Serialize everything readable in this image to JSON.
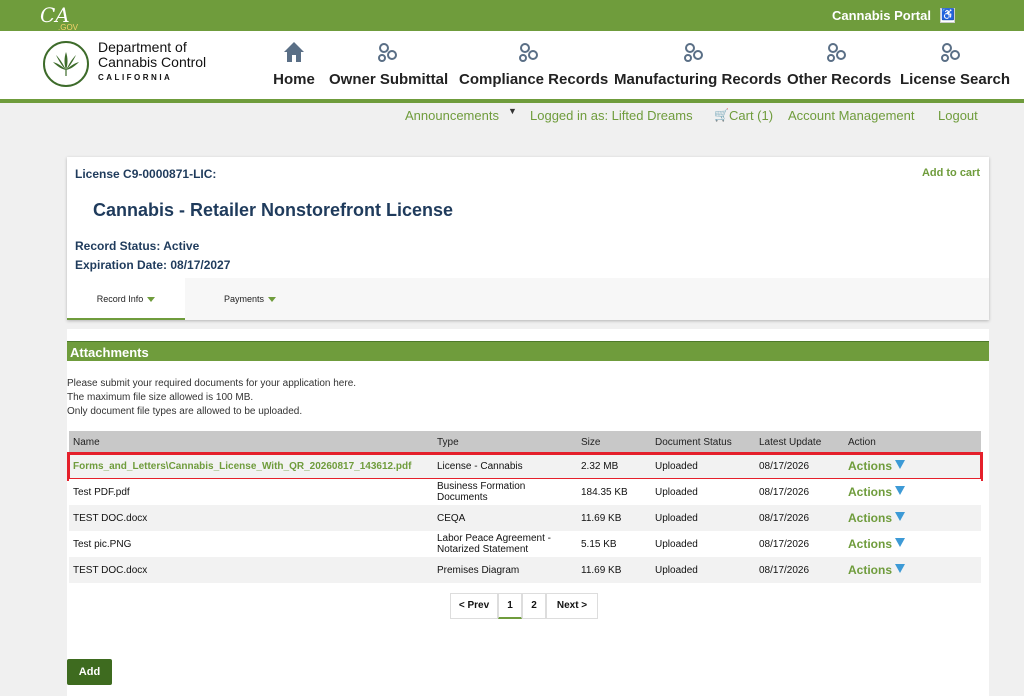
{
  "topbar": {
    "logo_text": "CA",
    "logo_sub": ".GOV",
    "portal_title": "Cannabis Portal"
  },
  "dept": {
    "line1": "Department of",
    "line2": "Cannabis Control",
    "line3": "CALIFORNIA"
  },
  "nav": [
    {
      "label": "Home",
      "icon": "home-icon"
    },
    {
      "label": "Owner Submittal",
      "icon": "gears-icon"
    },
    {
      "label": "Compliance Records",
      "icon": "gears-icon"
    },
    {
      "label": "Manufacturing Records",
      "icon": "gears-icon"
    },
    {
      "label": "Other Records",
      "icon": "gears-icon"
    },
    {
      "label": "License Search",
      "icon": "gears-icon"
    }
  ],
  "subnav": {
    "announcements": "Announcements",
    "logged_in": "Logged in as: Lifted Dreams",
    "cart": "Cart (1)",
    "account": "Account Management",
    "logout": "Logout"
  },
  "record": {
    "license_number": "License C9-0000871-LIC:",
    "add_to_cart": "Add to cart",
    "license_type": "Cannabis - Retailer Nonstorefront License",
    "status": "Record Status: Active",
    "expiration": "Expiration Date: 08/17/2027",
    "tabs": [
      "Record Info",
      "Payments"
    ]
  },
  "attachments": {
    "title": "Attachments",
    "notes": [
      "Please submit your required documents for your application here.",
      "The maximum file size allowed is 100 MB.",
      "Only document file types are allowed to be uploaded."
    ],
    "columns": [
      "Name",
      "Type",
      "Size",
      "Document Status",
      "Latest Update",
      "Action"
    ],
    "rows": [
      {
        "name": "Forms_and_Letters\\Cannabis_License_With_QR_20260817_143612.pdf",
        "type": "License - Cannabis",
        "size": "2.32 MB",
        "status": "Uploaded",
        "updated": "08/17/2026",
        "action": "Actions"
      },
      {
        "name": "Test PDF.pdf",
        "type": "Business Formation Documents",
        "size": "184.35 KB",
        "status": "Uploaded",
        "updated": "08/17/2026",
        "action": "Actions"
      },
      {
        "name": "TEST DOC.docx",
        "type": "CEQA",
        "size": "11.69 KB",
        "status": "Uploaded",
        "updated": "08/17/2026",
        "action": "Actions"
      },
      {
        "name": "Test pic.PNG",
        "type": "Labor Peace Agreement - Notarized Statement",
        "size": "5.15 KB",
        "status": "Uploaded",
        "updated": "08/17/2026",
        "action": "Actions"
      },
      {
        "name": "TEST DOC.docx",
        "type": "Premises Diagram",
        "size": "11.69 KB",
        "status": "Uploaded",
        "updated": "08/17/2026",
        "action": "Actions"
      }
    ],
    "pager": {
      "prev": "< Prev",
      "pages": [
        "1",
        "2"
      ],
      "next": "Next >"
    },
    "add_button": "Add"
  },
  "colors": {
    "brand_green": "#6f9c3c",
    "dark_green": "#3e6b1f",
    "navy": "#1f3b5c",
    "highlight_red": "#e5202b",
    "action_arrow": "#3d9ad6"
  }
}
